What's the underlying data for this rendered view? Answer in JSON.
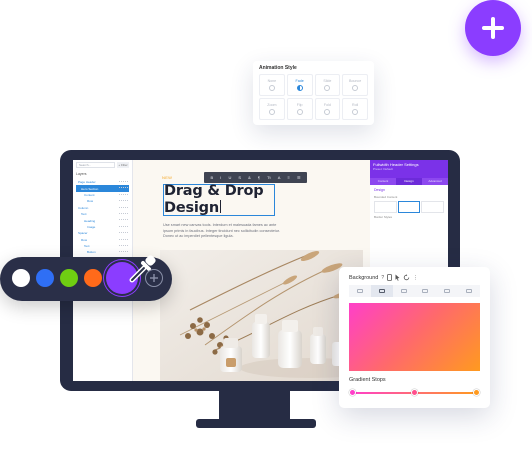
{
  "animation": {
    "title": "Animation Style",
    "options": [
      {
        "label": "None",
        "active": false
      },
      {
        "label": "Fade",
        "active": true
      },
      {
        "label": "Slide",
        "active": false
      },
      {
        "label": "Bounce",
        "active": false
      },
      {
        "label": "Zoom",
        "active": false
      },
      {
        "label": "Flip",
        "active": false
      },
      {
        "label": "Fold",
        "active": false
      },
      {
        "label": "Roll",
        "active": false
      }
    ]
  },
  "layers": {
    "search_placeholder": "Search...",
    "filter_label": "+ Filter",
    "title": "Layers",
    "rows": [
      {
        "label": "Page Header",
        "selected": false
      },
      {
        "label": "Hero Section",
        "selected": true
      },
      {
        "label": "Content",
        "selected": false
      },
      {
        "label": "Row",
        "selected": false
      },
      {
        "label": "Column",
        "selected": false
      },
      {
        "label": "Text",
        "selected": false
      },
      {
        "label": "Heading",
        "selected": false
      },
      {
        "label": "Image",
        "selected": false
      },
      {
        "label": "Spacer",
        "selected": false
      },
      {
        "label": "Row",
        "selected": false
      },
      {
        "label": "Text",
        "selected": false
      },
      {
        "label": "Button",
        "selected": false
      },
      {
        "label": "Testimonial",
        "selected": false
      },
      {
        "label": "Gallery",
        "selected": false
      },
      {
        "label": "Footer",
        "selected": false
      },
      {
        "label": "Row",
        "selected": false
      },
      {
        "label": "Column",
        "selected": false
      },
      {
        "label": "Text",
        "selected": false
      }
    ],
    "last_row": "Footer"
  },
  "toolbar": {
    "items": [
      "B",
      "I",
      "U",
      "S",
      "&",
      "¶",
      "Tt",
      "A",
      "≡",
      "☰"
    ]
  },
  "canvas": {
    "eyebrow": "NEW",
    "headline_line1": "Drag & Drop",
    "headline_line2": "Design",
    "paragraph": "Use smart new canvas tools. Interdum et malesuada fames ac ante ipsum primis in faucibus. Integer tincidunt nec sollicitudin consectetur. Donec ut ac imperdiet pellentesque ligula."
  },
  "settings": {
    "title": "Fullwidth Header Settings",
    "subtitle": "Preset: Default",
    "tabs": [
      {
        "label": "Content",
        "active": false
      },
      {
        "label": "Design",
        "active": true
      },
      {
        "label": "Advanced",
        "active": false
      }
    ],
    "section": "Design",
    "label1": "Bounded Content",
    "label2": "Border Styles"
  },
  "palette": {
    "colors": [
      "#ffffff",
      "#2f6ff5",
      "#6fce12",
      "#ff6a1a",
      "#8b3dff"
    ],
    "selected_color": "#8b3dff"
  },
  "background": {
    "title": "Background",
    "gradient_start": "#ff3fc9",
    "gradient_end": "#ff9a1f",
    "stops_label": "Gradient Stops",
    "stops": [
      "#ff3fc9",
      "#ff4f8c",
      "#ff9a1f"
    ]
  },
  "accent": "#8b3dff"
}
